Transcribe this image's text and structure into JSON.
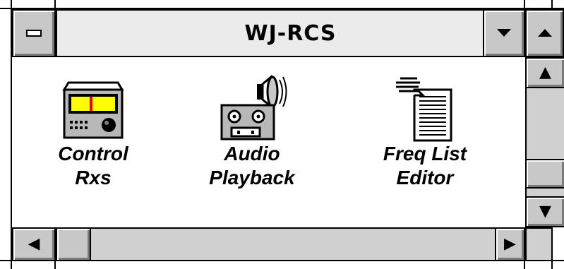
{
  "window": {
    "title": "WJ-RCS",
    "control_icons": {
      "system_menu": "minus-bar-icon",
      "minimize": "down-triangle-icon",
      "maximize": "up-triangle-icon"
    }
  },
  "program_items": [
    {
      "label": "Control\nRxs",
      "icon": "radio-receiver-icon"
    },
    {
      "label": "Audio\nPlayback",
      "icon": "tape-recorder-speaker-icon"
    },
    {
      "label": "Freq List\nEditor",
      "icon": "hand-document-icon"
    }
  ],
  "scrollbars": {
    "vertical": {
      "up_arrow": "▲",
      "down_arrow": "▼"
    },
    "horizontal": {
      "left_arrow": "◀",
      "right_arrow": "▶"
    }
  },
  "colors": {
    "titlebar": "#ebebeb",
    "button_face": "#c8c8c8",
    "meter_yellow": "#ffff00",
    "needle_red": "#e00000"
  }
}
